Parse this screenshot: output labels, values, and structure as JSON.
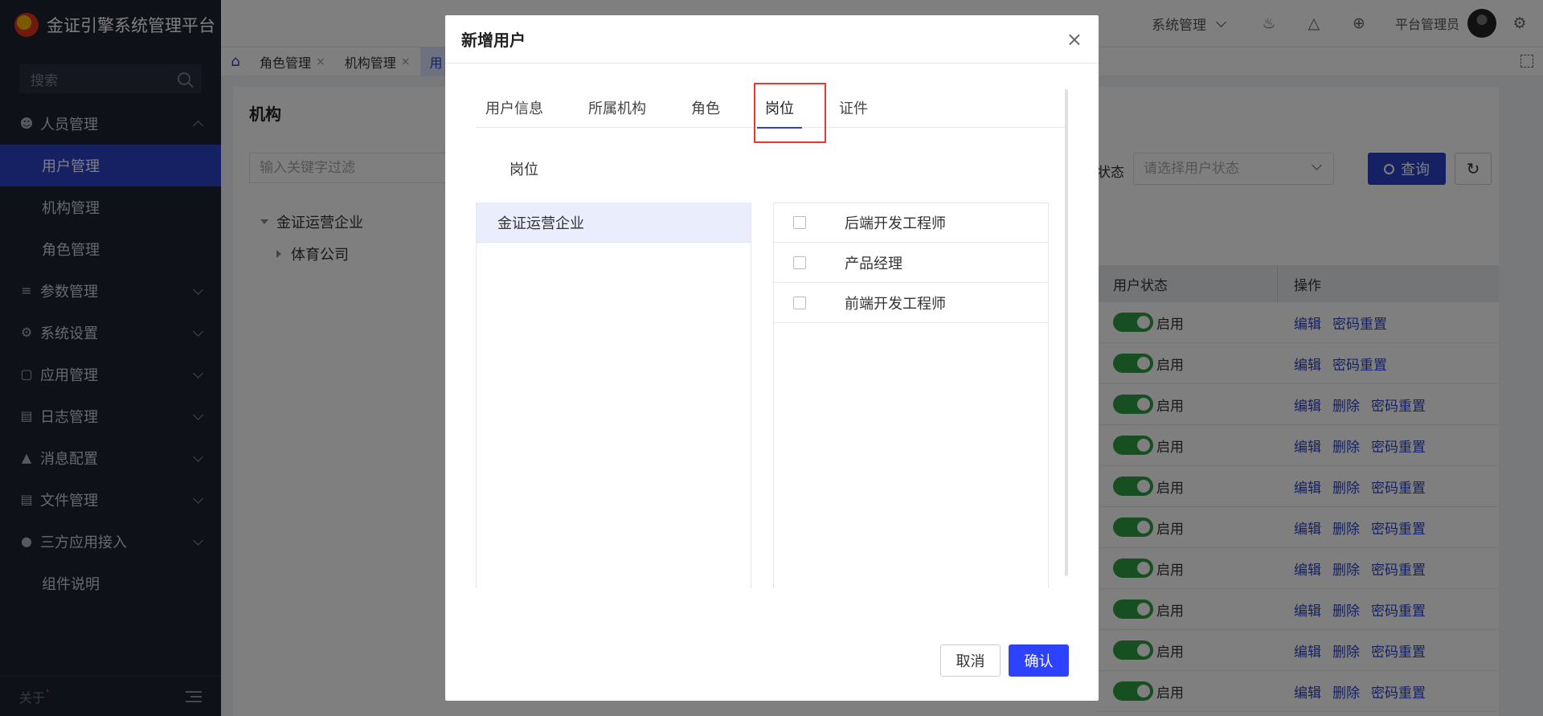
{
  "app": {
    "title": "金证引擎系统管理平台"
  },
  "sidebar": {
    "search_placeholder": "搜索",
    "groups": [
      {
        "label": "人员管理",
        "icon": "user-icon",
        "expanded": true
      },
      {
        "label": "参数管理",
        "icon": "sliders-icon"
      },
      {
        "label": "系统设置",
        "icon": "gear-icon"
      },
      {
        "label": "应用管理",
        "icon": "box-icon"
      },
      {
        "label": "日志管理",
        "icon": "document-icon"
      },
      {
        "label": "消息配置",
        "icon": "cubes-icon"
      },
      {
        "label": "文件管理",
        "icon": "file-icon"
      },
      {
        "label": "三方应用接入",
        "icon": "globe-icon"
      }
    ],
    "sub_items": [
      "用户管理",
      "机构管理",
      "角色管理"
    ],
    "extra_item": "组件说明",
    "footer_about": "关于",
    "footer_dot": "•"
  },
  "topbar": {
    "system_menu": "系统管理",
    "user_name": "平台管理员"
  },
  "tabsbar": {
    "tabs": [
      "角色管理",
      "机构管理",
      "用"
    ],
    "close_glyph": "×"
  },
  "main": {
    "title": "机构",
    "filter_placeholder": "输入关键字过滤",
    "tree": {
      "root": "金证运营企业",
      "child": "体育公司"
    },
    "status_label": "状态",
    "status_placeholder": "请选择用户状态",
    "query_button": "查询",
    "table": {
      "headers": [
        "用户状态",
        "操作"
      ],
      "rows": [
        {
          "status": "启用",
          "actions": [
            "编辑",
            "密码重置"
          ]
        },
        {
          "status": "启用",
          "actions": [
            "编辑",
            "密码重置"
          ]
        },
        {
          "status": "启用",
          "actions": [
            "编辑",
            "删除",
            "密码重置"
          ]
        },
        {
          "status": "启用",
          "actions": [
            "编辑",
            "删除",
            "密码重置"
          ]
        },
        {
          "status": "启用",
          "actions": [
            "编辑",
            "删除",
            "密码重置"
          ]
        },
        {
          "status": "启用",
          "actions": [
            "编辑",
            "删除",
            "密码重置"
          ]
        },
        {
          "status": "启用",
          "actions": [
            "编辑",
            "删除",
            "密码重置"
          ]
        },
        {
          "status": "启用",
          "actions": [
            "编辑",
            "删除",
            "密码重置"
          ]
        },
        {
          "status": "启用",
          "actions": [
            "编辑",
            "删除",
            "密码重置"
          ]
        },
        {
          "status": "启用",
          "actions": [
            "编辑",
            "删除",
            "密码重置"
          ]
        }
      ]
    }
  },
  "modal": {
    "title": "新增用户",
    "close_glyph": "×",
    "tabs": [
      "用户信息",
      "所属机构",
      "角色",
      "岗位",
      "证件"
    ],
    "active_tab": "岗位",
    "section_label": "岗位",
    "org_list": [
      "金证运营企业"
    ],
    "positions": [
      {
        "label": "后端开发工程师",
        "checked": false
      },
      {
        "label": "产品经理",
        "checked": false
      },
      {
        "label": "前端开发工程师",
        "checked": false
      }
    ],
    "cancel_label": "取消",
    "ok_label": "确认"
  },
  "colors": {
    "accent": "#2d42c9",
    "sidebar_bg": "#1f2233",
    "switch_on": "#2f9e44",
    "highlight": "#e53935"
  }
}
